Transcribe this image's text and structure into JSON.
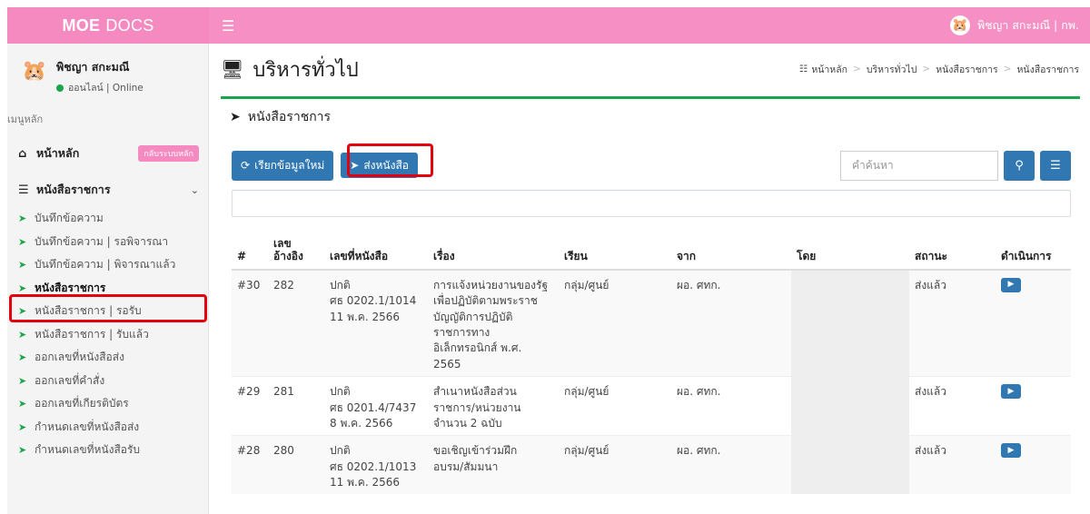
{
  "app": {
    "brand_bold": "MOE",
    "brand_rest": "DOCS",
    "top_user": "พิชญา สกะมณี | กพ."
  },
  "sidebar": {
    "user_name": "พิชญา สกะมณี",
    "user_status": "ออนไลน์ | Online",
    "menu_header": "เมนูหลัก",
    "home_label": "หน้าหลัก",
    "home_badge": "กลับระบบหลัก",
    "group_label": "หนังสือราชการ",
    "items": [
      {
        "label": "บันทึกข้อความ"
      },
      {
        "label": "บันทึกข้อความ | รอพิจารณา"
      },
      {
        "label": "บันทึกข้อความ | พิจารณาแล้ว"
      },
      {
        "label": "หนังสือราชการ"
      },
      {
        "label": "หนังสือราชการ | รอรับ"
      },
      {
        "label": "หนังสือราชการ | รับแล้ว"
      },
      {
        "label": "ออกเลขที่หนังสือส่ง"
      },
      {
        "label": "ออกเลขที่คำสั่ง"
      },
      {
        "label": "ออกเลขที่เกียรติบัตร"
      },
      {
        "label": "กำหนดเลขที่หนังสือส่ง"
      },
      {
        "label": "กำหนดเลขที่หนังสือรับ"
      }
    ]
  },
  "page": {
    "title": "บริหารทั่วไป",
    "breadcrumb": [
      "หน้าหลัก",
      "บริหารทั่วไป",
      "หนังสือราชการ",
      "หนังสือราชการ"
    ],
    "box_title": "หนังสือราชการ",
    "reload_label": "เรียกข้อมูลใหม่",
    "send_label": "ส่งหนังสือ",
    "search_placeholder": "คำค้นหา"
  },
  "table": {
    "headers": {
      "num": "#",
      "ref": "เลข\nอ้างอิง",
      "doc_no": "เลขที่หนังสือ",
      "subject": "เรื่อง",
      "to": "เรียน",
      "from": "จาก",
      "by": "โดย",
      "status": "สถานะ",
      "action": "ดำเนินการ"
    },
    "rows": [
      {
        "num": "#30",
        "ref": "282",
        "doc_no": "ปกติ\nศธ 0202.1/1014\n11 พ.ค. 2566",
        "subject": "การแจ้งหน่วยงานของรัฐ\nเพื่อปฏิบัติตามพระราช\nบัญญัติการปฏิบัติ\nราชการทาง\nอิเล็กทรอนิกส์ พ.ศ.\n2565",
        "to": "กลุ่ม/ศูนย์",
        "from": "ผอ. ศทก.",
        "by": "",
        "status": "ส่งแล้ว"
      },
      {
        "num": "#29",
        "ref": "281",
        "doc_no": "ปกติ\nศธ 0201.4/7437\n8 พ.ค. 2566",
        "subject": "สำเนาหนังสือส่วน\nราชการ/หน่วยงาน\nจำนวน 2 ฉบับ",
        "to": "กลุ่ม/ศูนย์",
        "from": "ผอ. ศทก.",
        "by": "",
        "status": "ส่งแล้ว"
      },
      {
        "num": "#28",
        "ref": "280",
        "doc_no": "ปกติ\nศธ 0202.1/1013\n11 พ.ค. 2566",
        "subject": "ขอเชิญเข้าร่วมฝึก\nอบรม/สัมมนา",
        "to": "กลุ่ม/ศูนย์",
        "from": "ผอ. ศทก.",
        "by": "",
        "status": "ส่งแล้ว"
      }
    ]
  },
  "colors": {
    "topbar": "#f690c4",
    "accent_green": "#1aa64b",
    "button_blue": "#3178b3",
    "highlight_red": "#e3000f"
  },
  "icons": {
    "hamburger": "menu-icon",
    "monitor": "monitor-icon",
    "sitemap": "sitemap-icon",
    "sign_in": "sign-in-icon",
    "refresh": "refresh-icon",
    "send": "paper-plane-icon",
    "search": "search-icon",
    "list": "list-icon",
    "folder": "folder-open-icon"
  }
}
